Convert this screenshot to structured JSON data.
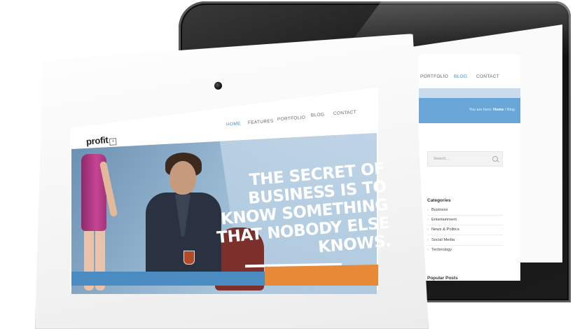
{
  "back_site": {
    "nav": {
      "portfolio": "PORTFOLIO",
      "blog": "BLOG",
      "contact": "CONTACT"
    },
    "breadcrumb": {
      "prefix": "You are here:",
      "home": "Home",
      "separator": "/",
      "current": "Blog"
    },
    "search_placeholder": "Search...",
    "categories_title": "Categories",
    "categories": [
      "Business",
      "Entertainment",
      "News & Politics",
      "Social Media",
      "Technology"
    ],
    "popular_title": "Popular Posts"
  },
  "front_site": {
    "logo": "profit",
    "logo_symbol": "+",
    "nav": {
      "home": "HOME",
      "features": "FEATURES",
      "portfolio": "PORTFOLIO",
      "blog": "BLOG",
      "contact": "CONTACT"
    },
    "hero_lines": [
      "THE SECRET OF",
      "BUSINESS IS TO",
      "KNOW SOMETHING",
      "THAT NOBODY ELSE",
      "KNOWS."
    ]
  },
  "colors": {
    "accent_blue": "#4a8bc2",
    "accent_orange": "#e88937",
    "banner_blue": "#6aa7d8"
  }
}
